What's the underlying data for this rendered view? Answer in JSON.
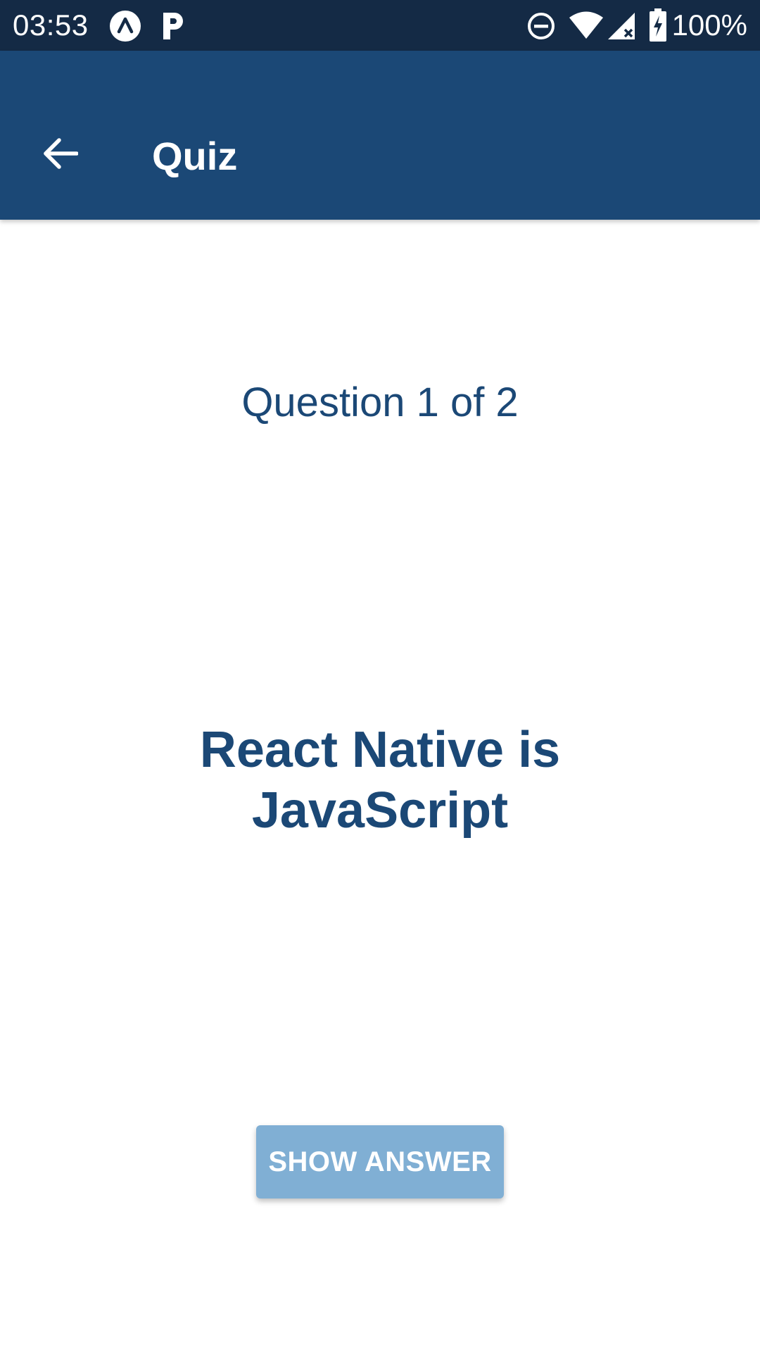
{
  "status_bar": {
    "time": "03:53",
    "battery_percent": "100%",
    "icons": [
      "expo-icon",
      "p-icon",
      "do-not-disturb-icon",
      "wifi-icon",
      "signal-icon",
      "battery-charging-icon"
    ]
  },
  "app_bar": {
    "title": "Quiz",
    "back_icon": "arrow-back-icon"
  },
  "quiz": {
    "progress": "Question 1 of 2",
    "current_question": 1,
    "total_questions": 2,
    "question": "React Native is JavaScript",
    "show_answer_label": "SHOW ANSWER"
  },
  "colors": {
    "status_bar": "#142a45",
    "app_bar": "#1b4876",
    "accent_text": "#1b4876",
    "button": "#80afd4",
    "background": "#ffffff"
  }
}
